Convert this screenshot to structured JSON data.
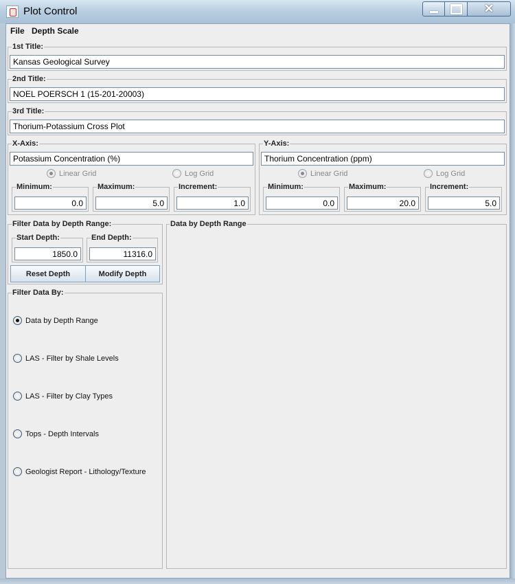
{
  "window": {
    "title": "Plot Control"
  },
  "menu": {
    "file": "File",
    "depth_scale": "Depth Scale"
  },
  "titles": {
    "t1_label": "1st Title:",
    "t1_value": "Kansas Geological Survey",
    "t2_label": "2nd Title:",
    "t2_value": "NOEL POERSCH 1 (15-201-20003)",
    "t3_label": "3rd Title:",
    "t3_value": "Thorium-Potassium Cross Plot"
  },
  "x_axis": {
    "label": "X-Axis:",
    "title": "Potassium Concentration (%)",
    "linear": "Linear Grid",
    "log": "Log Grid",
    "selected_grid": "Linear Grid",
    "min_label": "Minimum:",
    "min": "0.0",
    "max_label": "Maximum:",
    "max": "5.0",
    "inc_label": "Increment:",
    "inc": "1.0"
  },
  "y_axis": {
    "label": "Y-Axis:",
    "title": "Thorium Concentration (ppm)",
    "linear": "Linear Grid",
    "log": "Log Grid",
    "selected_grid": "Linear Grid",
    "min_label": "Minimum:",
    "min": "0.0",
    "max_label": "Maximum:",
    "max": "20.0",
    "inc_label": "Increment:",
    "inc": "5.0"
  },
  "depth_filter": {
    "label": "Filter Data by Depth Range:",
    "start_label": "Start Depth:",
    "start": "1850.0",
    "end_label": "End Depth:",
    "end": "11316.0",
    "reset": "Reset Depth",
    "modify": "Modify Depth"
  },
  "filter_by": {
    "label": "Filter Data By:",
    "options": [
      "Data by Depth Range",
      "LAS - Filter by Shale Levels",
      "LAS - Filter by Clay Types",
      "Tops - Depth Intervals",
      "Geologist Report - Lithology/Texture"
    ],
    "selected": "Data by Depth Range"
  },
  "right_panel": {
    "label": "Data by Depth Range"
  }
}
